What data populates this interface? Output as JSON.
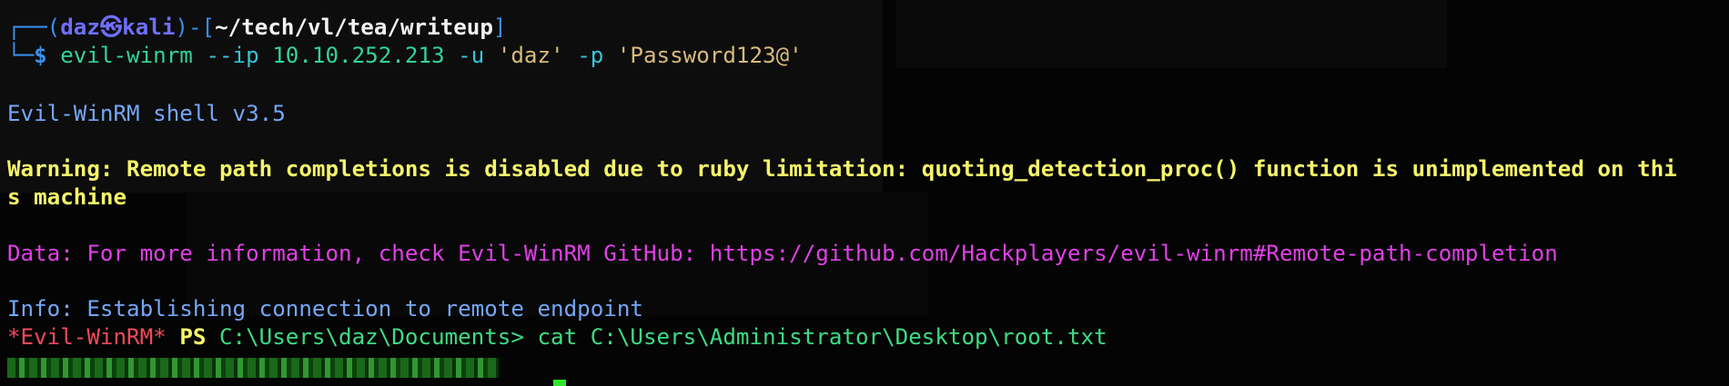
{
  "prompt": {
    "frame_open": "┌──(",
    "user": "daz",
    "skull": "㉿",
    "host": "kali",
    "frame_mid": ")-[",
    "path": "~/tech/vl/tea/writeup",
    "frame_close": "]",
    "frame_bottom": "└─",
    "dollar": "$"
  },
  "command": {
    "program": "evil-winrm",
    "ip_flag": "--ip",
    "ip": "10.10.252.213",
    "user_flag": "-u",
    "user": "'daz'",
    "pass_flag": "-p",
    "password": "'Password123@'"
  },
  "output": {
    "banner": "Evil-WinRM shell v3.5",
    "warning_line1": "Warning: Remote path completions is disabled due to ruby limitation: quoting_detection_proc() function is unimplemented on thi",
    "warning_line2": "s machine",
    "data_line": "Data: For more information, check Evil-WinRM GitHub: https://github.com/Hackplayers/evil-winrm#Remote-path-completion",
    "info_line": "Info: Establishing connection to remote endpoint"
  },
  "ps_prompt": {
    "tag": "*Evil-WinRM*",
    "ps": "PS",
    "cwd": "C:\\Users\\daz\\Documents>",
    "command": "cat C:\\Users\\Administrator\\Desktop\\root.txt"
  },
  "colors": {
    "background": "#040404",
    "prompt_frame": "#3b8eea",
    "user_host": "#6f6fff",
    "command": "#34d399",
    "warning": "#f5f56a",
    "data": "#e040e6",
    "info": "#74a7f7",
    "evil_tag": "#f04a5a",
    "cursor": "#2ee62e"
  }
}
